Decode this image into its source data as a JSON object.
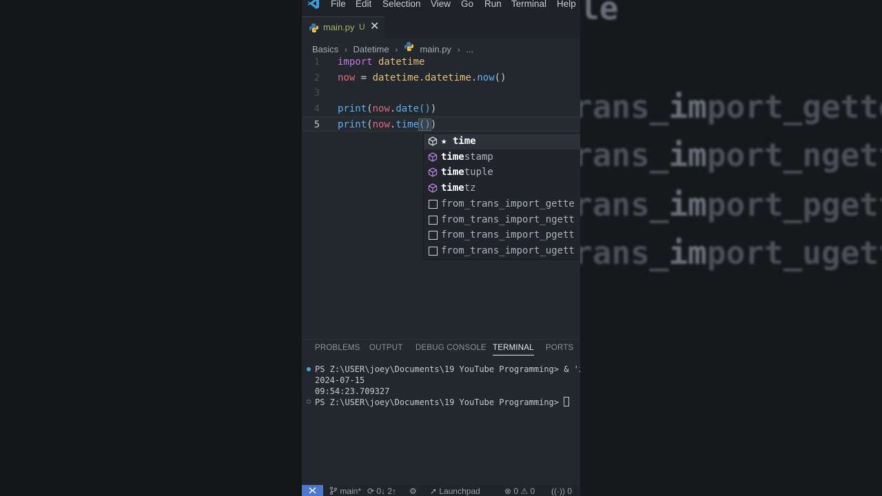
{
  "background": {
    "right_lines": [
      {
        "pre": "",
        "hl": "le",
        "post": ""
      },
      {
        "pre": "rans_",
        "hl": "im",
        "post": "port_gette"
      },
      {
        "pre": "rans_",
        "hl": "im",
        "post": "port_ngett"
      },
      {
        "pre": "rans_",
        "hl": "im",
        "post": "port_pgett"
      },
      {
        "pre": "rans_",
        "hl": "im",
        "post": "port_ugett"
      }
    ]
  },
  "menu": {
    "logo_icon": "vscode-logo-icon",
    "items": [
      "File",
      "Edit",
      "Selection",
      "View",
      "Go",
      "Run",
      "Terminal",
      "Help"
    ]
  },
  "tab": {
    "filename": "main.py",
    "status": "U",
    "close": "✕",
    "icon": "python-icon"
  },
  "breadcrumb": {
    "parts": [
      "Basics",
      "Datetime",
      "main.py",
      "..."
    ],
    "sep": "›"
  },
  "editor": {
    "line_numbers": [
      "1",
      "2",
      "3",
      "4",
      "5"
    ],
    "active_line": "5",
    "lines": [
      {
        "a": "import",
        "b": " datetime"
      },
      {
        "a": "now",
        "b": " = ",
        "c": "datetime",
        "d": ".",
        "e": "datetime",
        "f": ".",
        "g": "now",
        "h": "()"
      },
      {},
      {
        "a": "print",
        "b": "(",
        "c": "now",
        "d": ".",
        "e": "date",
        "f": "()",
        "g": ")"
      },
      {
        "a": "print",
        "b": "(",
        "c": "now",
        "d": ".",
        "e": "time",
        "f": "()",
        "g": ")"
      }
    ]
  },
  "suggestions": [
    {
      "match": "★ time",
      "rest": "",
      "kind": "method",
      "selected": true
    },
    {
      "match": "time",
      "rest": "stamp",
      "kind": "method"
    },
    {
      "match": "time",
      "rest": "tuple",
      "kind": "method"
    },
    {
      "match": "time",
      "rest": "tz",
      "kind": "method"
    },
    {
      "raw": "from_trans_import_gette",
      "kind": "text"
    },
    {
      "raw": "from_trans_import_ngett",
      "kind": "text"
    },
    {
      "raw": "from_trans_import_pgett",
      "kind": "text"
    },
    {
      "raw": "from_trans_import_ugett",
      "kind": "text"
    }
  ],
  "panel": {
    "tabs": [
      "PROBLEMS",
      "OUTPUT",
      "DEBUG CONSOLE",
      "TERMINAL",
      "PORTS"
    ],
    "active_tab": "TERMINAL"
  },
  "terminal": {
    "lines": [
      "PS Z:\\USER\\joey\\Documents\\19 YouTube Programming> & 'z",
      "2024-07-15",
      "09:54:23.709327",
      "PS Z:\\USER\\joey\\Documents\\19 YouTube Programming> "
    ],
    "dot_colors": [
      "#4aa3df",
      "#6b7079"
    ]
  },
  "status": {
    "remote_icon": "remote-icon",
    "branch": "main*",
    "sync": "0↓ 2↑",
    "launchpad": "Launchpad",
    "errors": "0",
    "warnings": "0",
    "ports": "0"
  },
  "colors": {
    "accent": "#4d78cc",
    "editor_bg": "#23272e",
    "keyword": "#c678dd",
    "function": "#61afef"
  }
}
